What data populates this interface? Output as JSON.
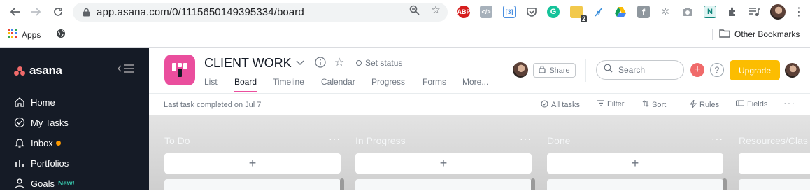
{
  "browser": {
    "url": "app.asana.com/0/1115650149395334/board",
    "bookmarks_bar": {
      "apps_label": "Apps",
      "other_bookmarks_label": "Other Bookmarks"
    },
    "extensions": [
      {
        "name": "adblock-plus-icon",
        "label": "ABP",
        "color": "#d61e1e"
      },
      {
        "name": "code-extension-icon",
        "label": "</>",
        "color": "#a7b1bb"
      },
      {
        "name": "blue-extension-icon",
        "label": "</>",
        "color": "#4a8fe0"
      },
      {
        "name": "pocket-icon",
        "label": "",
        "color": "#ffffff"
      },
      {
        "name": "grammarly-icon",
        "label": "G",
        "color": "#15c39a"
      },
      {
        "name": "yellow-extension-icon",
        "label": "2",
        "color": "#f2c94c"
      },
      {
        "name": "feather-icon",
        "label": "",
        "color": "#ffffff"
      },
      {
        "name": "google-drive-icon",
        "label": "",
        "color": "#ffffff"
      },
      {
        "name": "facebook-icon",
        "label": "f",
        "color": "#8f979e"
      },
      {
        "name": "flower-icon",
        "label": "",
        "color": "#ffffff"
      },
      {
        "name": "camera-icon",
        "label": "",
        "color": "#ffffff"
      },
      {
        "name": "n-extension-icon",
        "label": "N",
        "color": "#e0f4f3"
      }
    ]
  },
  "sidebar": {
    "logo": "asana",
    "items": [
      {
        "label": "Home",
        "icon": "home-icon"
      },
      {
        "label": "My Tasks",
        "icon": "check-circle-icon"
      },
      {
        "label": "Inbox",
        "icon": "bell-icon"
      },
      {
        "label": "Portfolios",
        "icon": "bar-chart-icon"
      },
      {
        "label": "Goals",
        "icon": "person-icon",
        "badge": "New!"
      }
    ]
  },
  "header": {
    "project_title": "CLIENT WORK",
    "set_status": "Set status",
    "tabs": [
      "List",
      "Board",
      "Timeline",
      "Calendar",
      "Progress",
      "Forms",
      "More..."
    ],
    "active_tab": "Board",
    "share_label": "Share",
    "search_placeholder": "Search",
    "upgrade_label": "Upgrade",
    "help_label": "?"
  },
  "subbar": {
    "last_task": "Last task completed on Jul 7",
    "tools": [
      "All tasks",
      "Filter",
      "Sort",
      "Rules",
      "Fields"
    ]
  },
  "board": {
    "columns": [
      {
        "title": "To Do"
      },
      {
        "title": "In Progress"
      },
      {
        "title": "Done"
      },
      {
        "title": "Resources/Clas"
      }
    ],
    "add_label": "+"
  },
  "colors": {
    "sidebar_bg": "#151b26",
    "project_icon": "#ea4e9d",
    "upgrade": "#fcbd01",
    "accent_red": "#f06a6a"
  }
}
